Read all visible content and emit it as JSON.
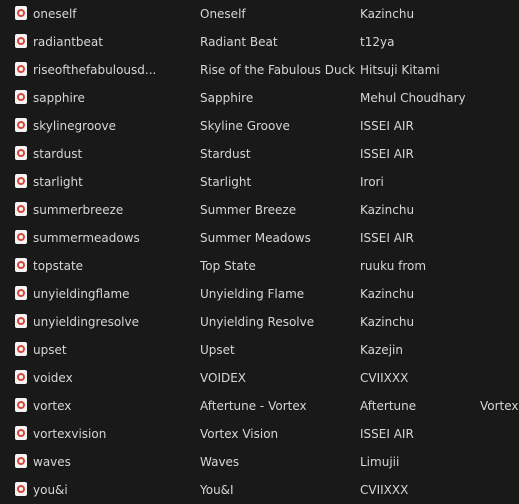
{
  "rows": [
    {
      "file": "oneself",
      "title": "Oneself",
      "artist": "Kazinchu",
      "extra": ""
    },
    {
      "file": "radiantbeat",
      "title": "Radiant Beat",
      "artist": "t12ya",
      "extra": ""
    },
    {
      "file": "riseofthefabulousd...",
      "title": "Rise of the Fabulous Duck",
      "artist": "Hitsuji Kitami",
      "extra": ""
    },
    {
      "file": "sapphire",
      "title": "Sapphire",
      "artist": "Mehul Choudhary",
      "extra": ""
    },
    {
      "file": "skylinegroove",
      "title": "Skyline Groove",
      "artist": "ISSEI AIR",
      "extra": ""
    },
    {
      "file": "stardust",
      "title": "Stardust",
      "artist": "ISSEI AIR",
      "extra": ""
    },
    {
      "file": "starlight",
      "title": "Starlight",
      "artist": "Irori",
      "extra": ""
    },
    {
      "file": "summerbreeze",
      "title": "Summer Breeze",
      "artist": "Kazinchu",
      "extra": ""
    },
    {
      "file": "summermeadows",
      "title": "Summer Meadows",
      "artist": "ISSEI AIR",
      "extra": ""
    },
    {
      "file": "topstate",
      "title": "Top State",
      "artist": "ruuku from",
      "extra": ""
    },
    {
      "file": "unyieldingflame",
      "title": "Unyielding Flame",
      "artist": "Kazinchu",
      "extra": ""
    },
    {
      "file": "unyieldingresolve",
      "title": "Unyielding Resolve",
      "artist": "Kazinchu",
      "extra": ""
    },
    {
      "file": "upset",
      "title": "Upset",
      "artist": "Kazejin",
      "extra": ""
    },
    {
      "file": "voidex",
      "title": "VOIDEX",
      "artist": "CVIIXXX",
      "extra": ""
    },
    {
      "file": "vortex",
      "title": "Aftertune - Vortex",
      "artist": "Aftertune",
      "extra": "Vortex"
    },
    {
      "file": "vortexvision",
      "title": "Vortex Vision",
      "artist": "ISSEI AIR",
      "extra": ""
    },
    {
      "file": "waves",
      "title": "Waves",
      "artist": "Limujii",
      "extra": ""
    },
    {
      "file": "you&i",
      "title": "You&I",
      "artist": "CVIIXXX",
      "extra": ""
    }
  ]
}
